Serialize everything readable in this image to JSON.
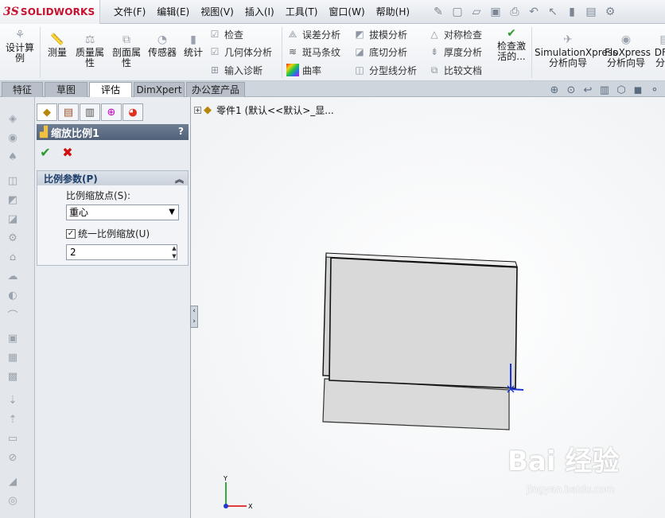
{
  "app": {
    "logo_ds": "3S",
    "logo_text": "SOLIDWORKS"
  },
  "menu": [
    "文件(F)",
    "编辑(E)",
    "视图(V)",
    "插入(I)",
    "工具(T)",
    "窗口(W)",
    "帮助(H)"
  ],
  "ribbon": {
    "design_study": "设计算例",
    "measure": "测量",
    "mass_props": "质量属性",
    "section_props": "剖面属性",
    "sensor": "传感器",
    "statistics": "统计",
    "check": "检查",
    "geometry_analysis": "几何体分析",
    "import_diag": "输入诊断",
    "deviation": "误差分析",
    "zebra": "斑马条纹",
    "curvature": "曲率",
    "draft": "拔模分析",
    "undercut": "底切分析",
    "parting_line": "分型线分析",
    "symmetry": "对称检查",
    "thickness": "厚度分析",
    "compare": "比较文档",
    "activate_check": "检查激活的...",
    "simxpress": "SimulationXpress 分析向导",
    "floxpress": "FloXpress 分析向导",
    "dfm": "DFM 分析"
  },
  "tabs": [
    "特征",
    "草图",
    "评估",
    "DimXpert",
    "办公室产品"
  ],
  "panel": {
    "title": "缩放比例1",
    "help": "?",
    "group_title": "比例参数(P)",
    "scale_about_label": "比例缩放点(S):",
    "scale_about_value": "重心",
    "uniform_label": "统一比例缩放(U)",
    "uniform_checked": "✓",
    "scale_value": "2"
  },
  "tree": {
    "node": "零件1  (默认<<默认>_显..."
  },
  "triad": {
    "x": "X",
    "y": "Y"
  },
  "watermark": {
    "text": "Bai 经验",
    "url": "jingyan.baidu.com"
  }
}
